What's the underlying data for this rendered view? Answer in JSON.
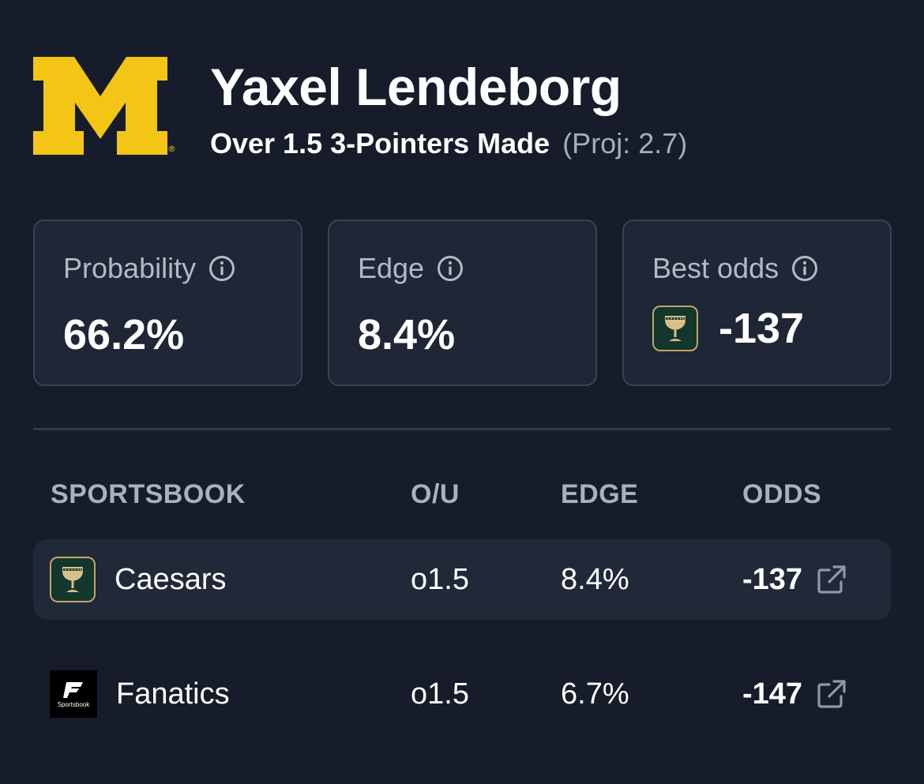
{
  "header": {
    "logo_icon": "michigan-block-m-logo",
    "logo_color": "#f3c515",
    "player_name": "Yaxel Lendeborg",
    "market": "Over 1.5 3-Pointers Made",
    "projection": "(Proj: 2.7)"
  },
  "cards": {
    "probability": {
      "label": "Probability",
      "value": "66.2%",
      "icon": "info-icon"
    },
    "edge": {
      "label": "Edge",
      "value": "8.4%",
      "icon": "info-icon"
    },
    "best_odds": {
      "label": "Best odds",
      "value": "-137",
      "icon": "info-icon",
      "book_icon": "caesars-logo"
    }
  },
  "table": {
    "headers": {
      "sportsbook": "SPORTSBOOK",
      "ou": "O/U",
      "edge": "EDGE",
      "odds": "ODDS"
    },
    "rows": [
      {
        "book": "Caesars",
        "book_icon": "caesars-logo",
        "ou": "o1.5",
        "edge": "8.4%",
        "odds": "-137",
        "link_icon": "external-link-icon",
        "highlighted": true
      },
      {
        "book": "Fanatics",
        "book_icon": "fanatics-logo",
        "book_logo_text": "Sportsbook",
        "ou": "o1.5",
        "edge": "6.7%",
        "odds": "-147",
        "link_icon": "external-link-icon",
        "highlighted": false
      }
    ]
  },
  "colors": {
    "background": "#161c29",
    "card_background": "#1f2636",
    "card_border": "#3a4254",
    "muted_text": "#a9b0c0",
    "caesars_green": "#13372c",
    "caesars_gold": "#c3a568"
  }
}
